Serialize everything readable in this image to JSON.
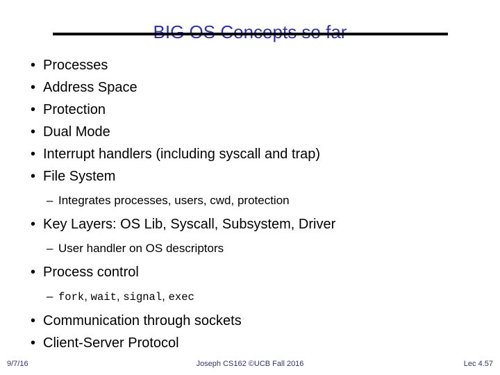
{
  "slide": {
    "title": "BIG OS Concepts so far",
    "title_color": "#3333a8",
    "rule_color": "#000000",
    "background": "#ffffff",
    "body_color": "#000000",
    "bullet_glyph": "•",
    "subbullet_glyph": "–",
    "bullets": [
      {
        "level": 1,
        "text": "Processes"
      },
      {
        "level": 1,
        "text": "Address Space"
      },
      {
        "level": 1,
        "text": "Protection"
      },
      {
        "level": 1,
        "text": "Dual Mode"
      },
      {
        "level": 1,
        "text": "Interrupt handlers (including syscall and trap)"
      },
      {
        "level": 1,
        "text": "File System"
      },
      {
        "level": 2,
        "text": "Integrates processes, users, cwd, protection"
      },
      {
        "level": 1,
        "text": "Key Layers: OS Lib, Syscall, Subsystem, Driver"
      },
      {
        "level": 2,
        "text": "User handler on OS descriptors"
      },
      {
        "level": 1,
        "text": "Process control"
      },
      {
        "level": 2,
        "text": "fork, wait, signal, exec",
        "mono_terms": [
          "fork",
          "wait",
          "signal",
          "exec"
        ]
      },
      {
        "level": 1,
        "text": "Communication through sockets"
      },
      {
        "level": 1,
        "text": "Client-Server Protocol"
      }
    ]
  },
  "footer": {
    "date": "9/7/16",
    "center": "Joseph CS162 ©UCB Fall 2016",
    "lecture": "Lec 4.57",
    "color": "#333366"
  }
}
